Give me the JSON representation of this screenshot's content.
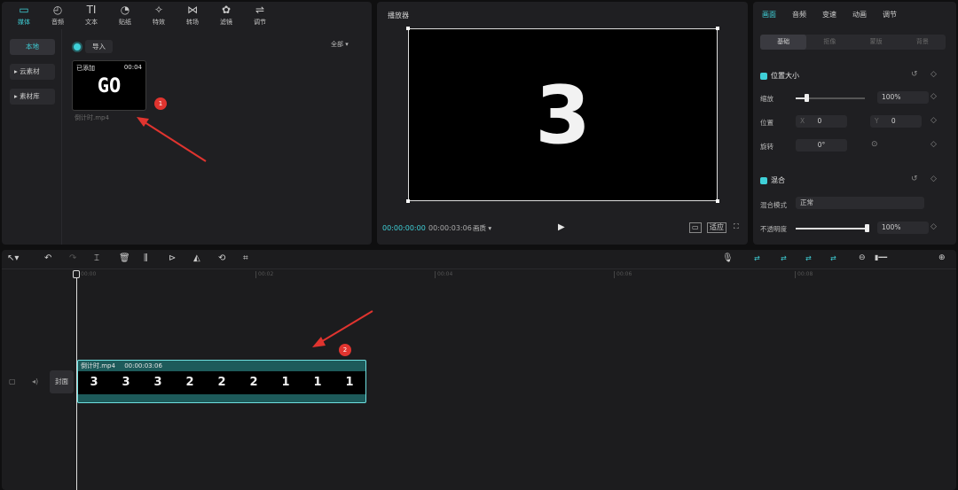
{
  "media": {
    "tabs": [
      {
        "label": "媒体",
        "icon": "▭"
      },
      {
        "label": "音频",
        "icon": "◴"
      },
      {
        "label": "文本",
        "icon": "TI"
      },
      {
        "label": "贴纸",
        "icon": "◔"
      },
      {
        "label": "特效",
        "icon": "✧"
      },
      {
        "label": "转场",
        "icon": "⋈"
      },
      {
        "label": "滤镜",
        "icon": "✿"
      },
      {
        "label": "调节",
        "icon": "⇌"
      }
    ],
    "side": [
      "本地",
      "▸ 云素材",
      "▸ 素材库"
    ],
    "import_label": "导入",
    "sort_label": "全部 ▾",
    "thumb": {
      "status": "已添加",
      "duration": "00:04",
      "text": "GO",
      "filename": "倒计时.mp4"
    }
  },
  "player": {
    "title": "播放器",
    "big_text": "3",
    "time_current": "00:00:00:00",
    "time_total": "00:00:03:06",
    "quality": "画质 ▾",
    "ratio_label": "适应"
  },
  "props": {
    "tabs": [
      "画面",
      "音频",
      "变速",
      "动画",
      "调节"
    ],
    "sub_tabs": [
      "基础",
      "抠像",
      "蒙版",
      "背景"
    ],
    "sec1": "位置大小",
    "scale_label": "缩放",
    "scale_value": "100%",
    "scale_level": 0.15,
    "pos_label": "位置",
    "pos_x_label": "X",
    "pos_x": "0",
    "pos_y_label": "Y",
    "pos_y": "0",
    "rot_label": "旋转",
    "rot_value": "0°",
    "sec2": "混合",
    "blend_label": "混合模式",
    "blend_value": "正常",
    "opacity_label": "不透明度",
    "opacity_value": "100%",
    "opacity_level": 1.0
  },
  "timeline": {
    "ruler": [
      "00:00",
      "00:02",
      "00:04",
      "00:06",
      "00:08"
    ],
    "cover_label": "封面",
    "clip_name": "倒计时.mp4",
    "clip_duration": "00:00:03:06",
    "frames": [
      "3",
      "3",
      "3",
      "2",
      "2",
      "2",
      "1",
      "1",
      "1"
    ]
  },
  "annotations": [
    "1",
    "2"
  ],
  "colors": {
    "accent": "#3fd0d8",
    "arrow": "#e0342f",
    "clip": "#1d5a5a"
  }
}
